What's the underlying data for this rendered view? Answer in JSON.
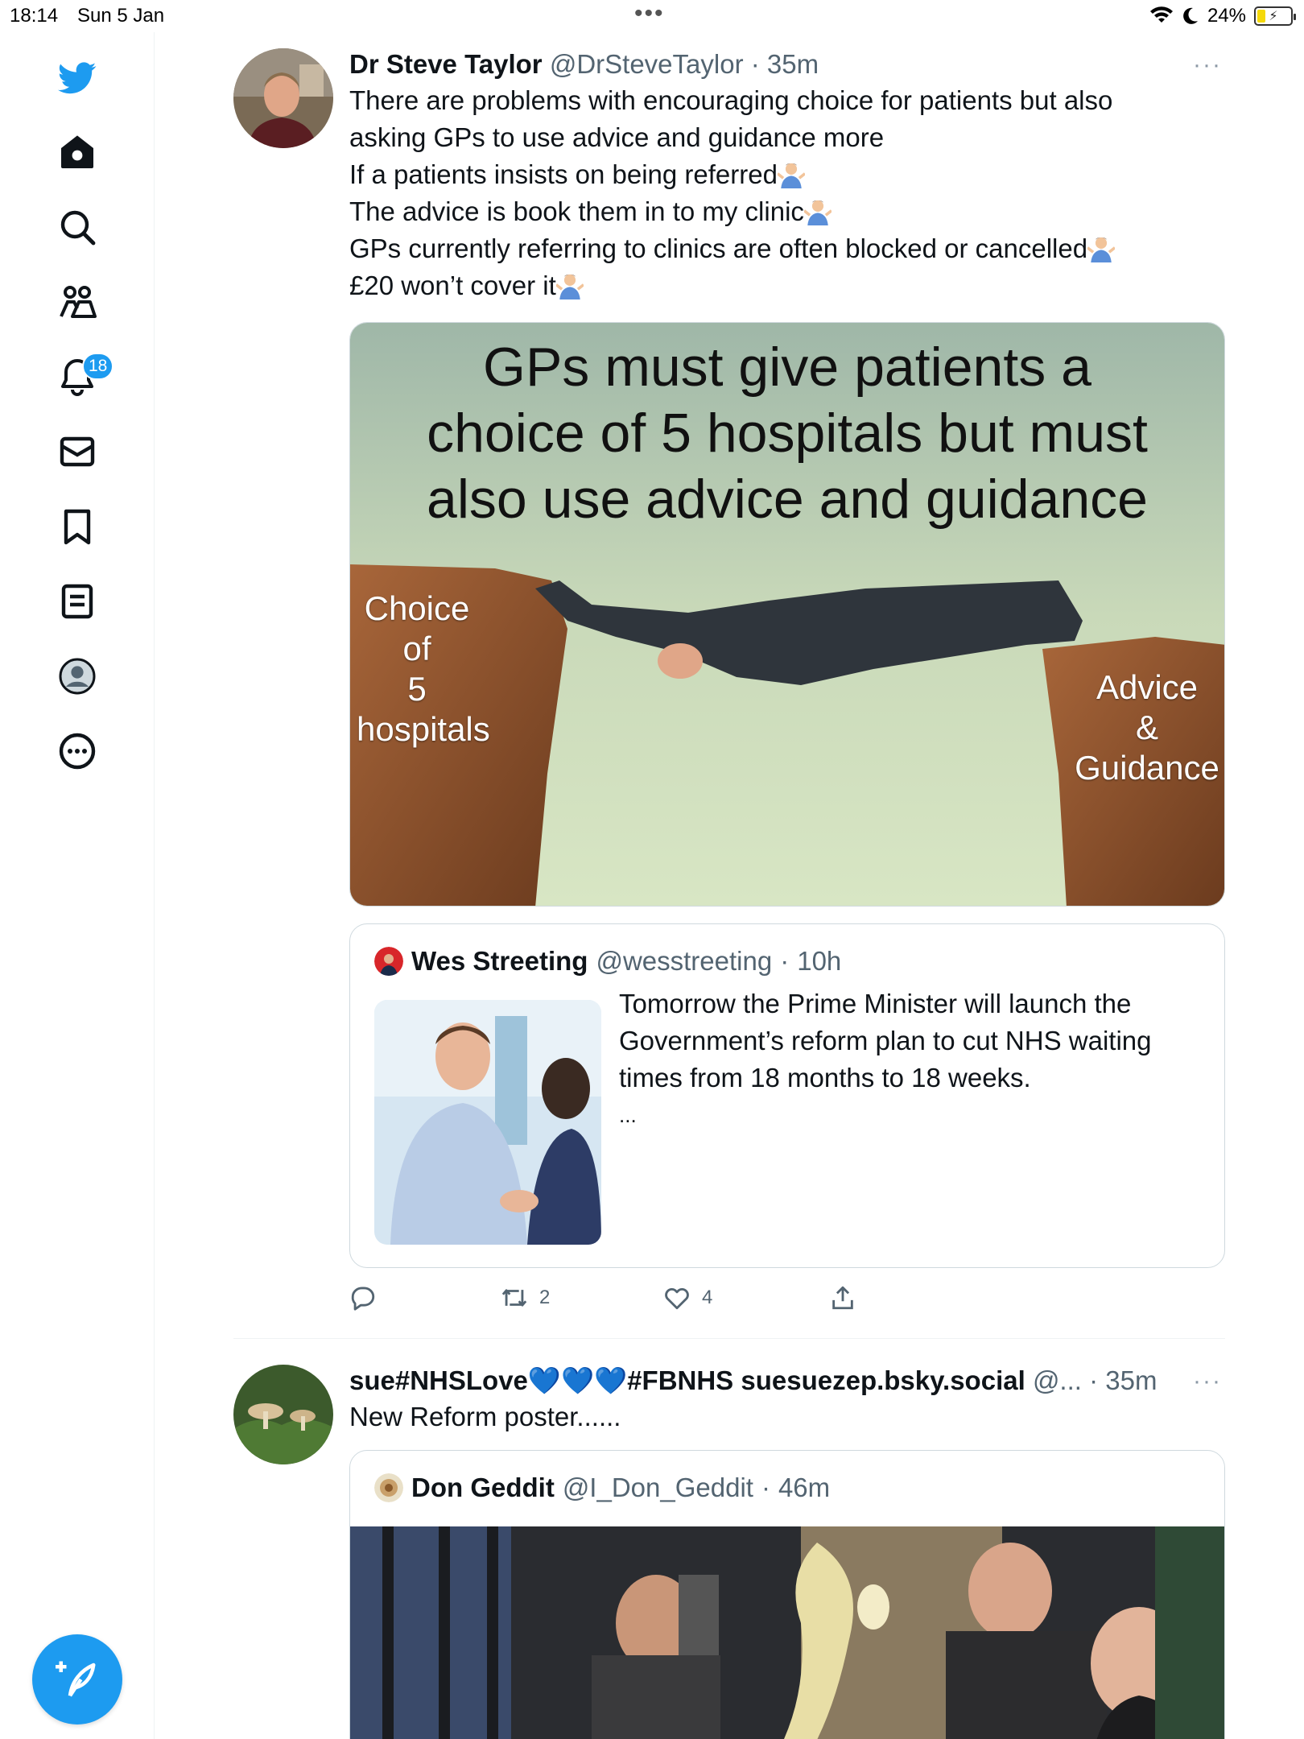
{
  "status_bar": {
    "time": "18:14",
    "date": "Sun 5 Jan",
    "battery_percent": "24%",
    "battery_level": 0.24
  },
  "sidebar": {
    "items": [
      {
        "name": "twitter-logo",
        "icon": "bird-icon"
      },
      {
        "name": "home",
        "icon": "home-icon"
      },
      {
        "name": "explore",
        "icon": "search-icon"
      },
      {
        "name": "communities",
        "icon": "people-icon"
      },
      {
        "name": "notifications",
        "icon": "bell-icon",
        "badge": "18"
      },
      {
        "name": "messages",
        "icon": "mail-icon"
      },
      {
        "name": "bookmarks",
        "icon": "bookmark-icon"
      },
      {
        "name": "lists",
        "icon": "list-icon"
      },
      {
        "name": "profile",
        "icon": "profile-icon"
      },
      {
        "name": "more",
        "icon": "more-circle-icon"
      }
    ],
    "compose_icon": "feather-plus-icon"
  },
  "colors": {
    "accent": "#1d9bf0",
    "text": "#0f1419",
    "muted": "#536471"
  },
  "tweets": [
    {
      "name": "Dr Steve Taylor",
      "handle": "@DrSteveTaylor",
      "sep": "·",
      "time": "35m",
      "more": "···",
      "lines": [
        "There are problems with encouraging choice for patients but also",
        "asking GPs to use advice and guidance more",
        "If a patients insists on being referred",
        "The advice is book them in to my clinic",
        "GPs currently referring to clinics are often blocked or cancelled",
        "£20 won’t cover it"
      ],
      "emoji": "man-shrugging",
      "image": {
        "title_lines": [
          "GPs must give patients a",
          "choice of 5 hospitals but must",
          "also use advice and guidance"
        ],
        "left_label_lines": [
          "Choice",
          "of",
          "5 hospitals"
        ],
        "right_label_lines": [
          "Advice",
          "&",
          "Guidance"
        ]
      },
      "quote": {
        "name": "Wes Streeting",
        "handle": "@wesstreeting",
        "sep": "·",
        "time": "10h",
        "lines": [
          "Tomorrow the Prime Minister will launch the",
          "Government’s reform plan to cut NHS waiting",
          "times from 18 months to 18 weeks.",
          "..."
        ]
      },
      "actions": {
        "reply_count": "",
        "retweet_count": "2",
        "like_count": "4"
      }
    },
    {
      "name": "sue#NHSLove💙💙💙#FBNHS suesuezep.bsky.social",
      "handle": "@...",
      "sep": "·",
      "time": "35m",
      "more": "···",
      "text": "New Reform poster......",
      "quote": {
        "name": "Don Geddit",
        "handle": "@I_Don_Geddit",
        "sep": "·",
        "time": "46m"
      }
    }
  ]
}
